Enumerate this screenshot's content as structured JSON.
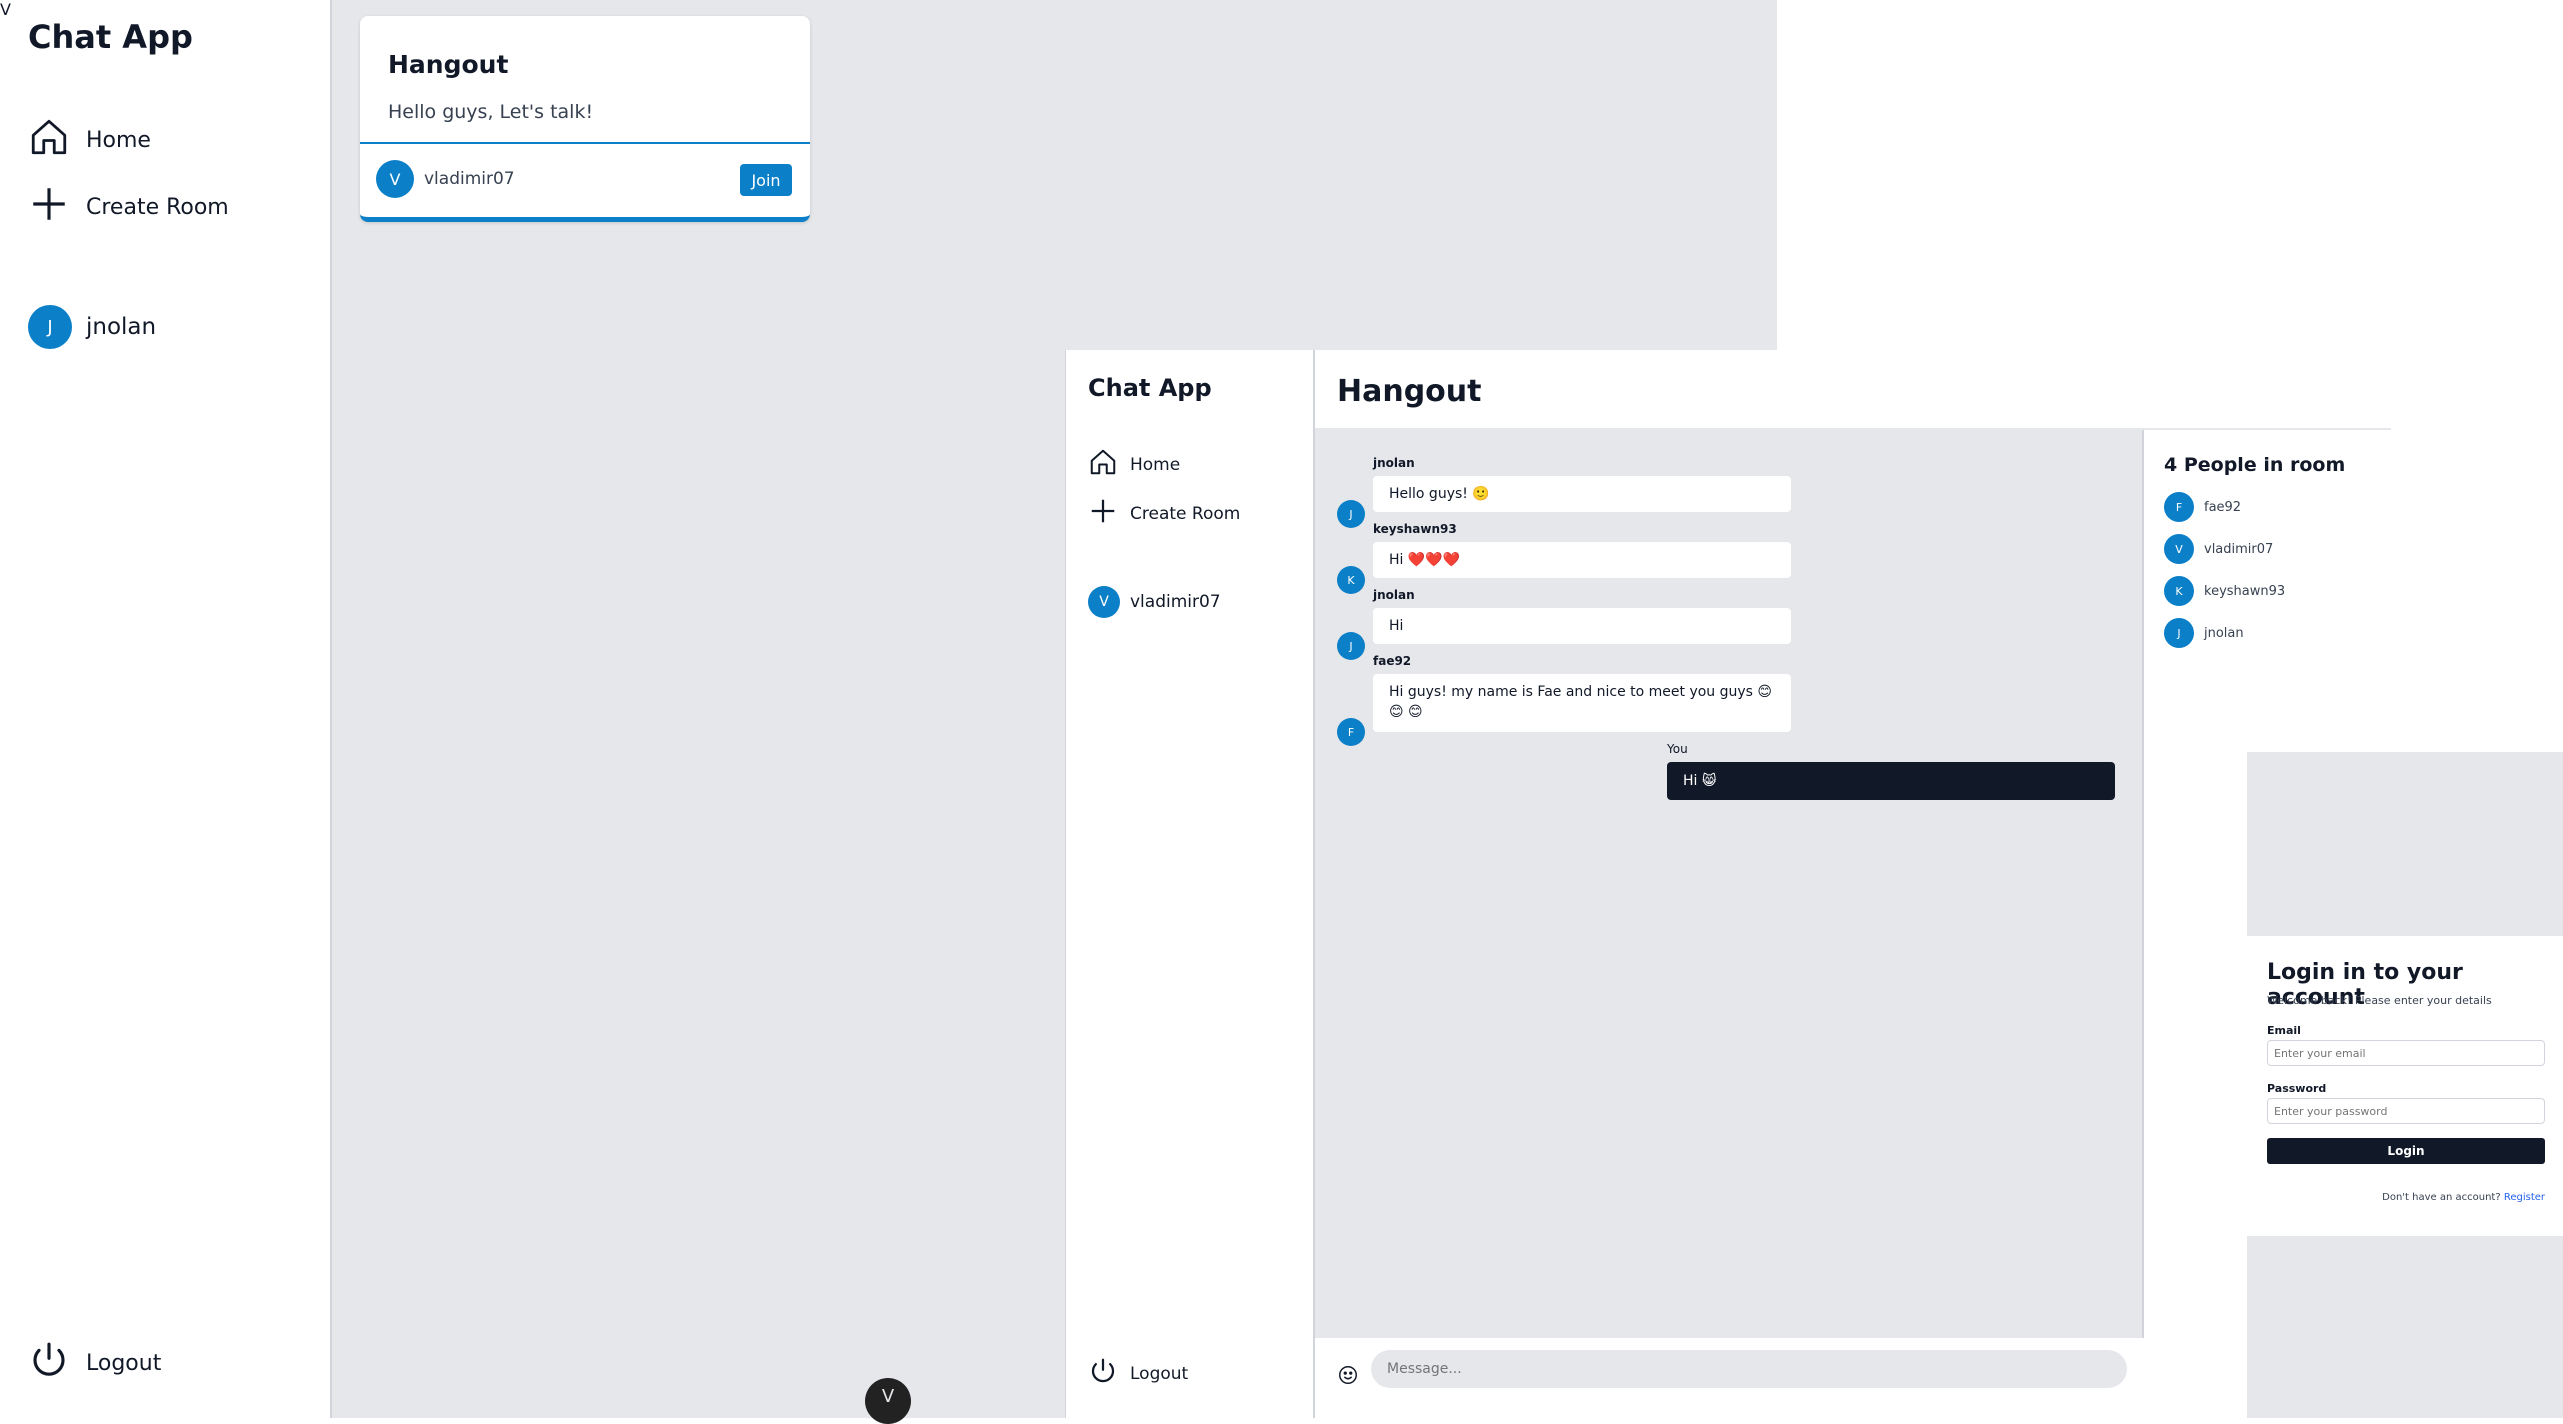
{
  "windows": {
    "home": {
      "app_title": "Chat App",
      "nav": [
        {
          "label": "Home",
          "icon": "home-icon"
        },
        {
          "label": "Create Room",
          "icon": "plus-icon"
        }
      ],
      "user": {
        "initial": "J",
        "name": "jnolan"
      },
      "logout_label": "Logout",
      "room_card": {
        "title": "Hangout",
        "description": "Hello guys, Let's talk!",
        "owner_initial": "V",
        "owner": "vladimir07",
        "join_label": "Join"
      },
      "badge_glyph": "V"
    },
    "chat": {
      "app_title": "Chat App",
      "nav": [
        {
          "label": "Home",
          "icon": "home-icon"
        },
        {
          "label": "Create Room",
          "icon": "plus-icon"
        }
      ],
      "user": {
        "initial": "V",
        "name": "vladimir07"
      },
      "logout_label": "Logout",
      "room_title": "Hangout",
      "messages": [
        {
          "author": "jnolan",
          "initial": "J",
          "text": "Hello guys! 🙂"
        },
        {
          "author": "keyshawn93",
          "initial": "K",
          "text": "Hi ❤️❤️❤️"
        },
        {
          "author": "jnolan",
          "initial": "J",
          "text": "Hi"
        },
        {
          "author": "fae92",
          "initial": "F",
          "text": "Hi guys! my name is Fae and nice to meet you guys 😊😊 😊"
        }
      ],
      "own_message": {
        "author": "You",
        "text": "Hi 😸"
      },
      "composer": {
        "placeholder": "Message..."
      },
      "people": {
        "title": "4 People in room",
        "list": [
          {
            "initial": "F",
            "name": "fae92"
          },
          {
            "initial": "V",
            "name": "vladimir07"
          },
          {
            "initial": "K",
            "name": "keyshawn93"
          },
          {
            "initial": "J",
            "name": "jnolan"
          }
        ]
      },
      "badge_glyph": "V"
    },
    "login": {
      "title": "Login in to your account",
      "subtitle": "Welcome back! Please enter your details",
      "email_label": "Email",
      "email_placeholder": "Enter your email",
      "password_label": "Password",
      "password_placeholder": "Enter your password",
      "login_button": "Login",
      "no_account_text": "Don't have an account?",
      "register_link": "Register"
    }
  },
  "colors": {
    "accent": "#0b7fc7",
    "dark": "#111827",
    "panel_bg": "#e5e7eb",
    "link": "#2563eb"
  }
}
